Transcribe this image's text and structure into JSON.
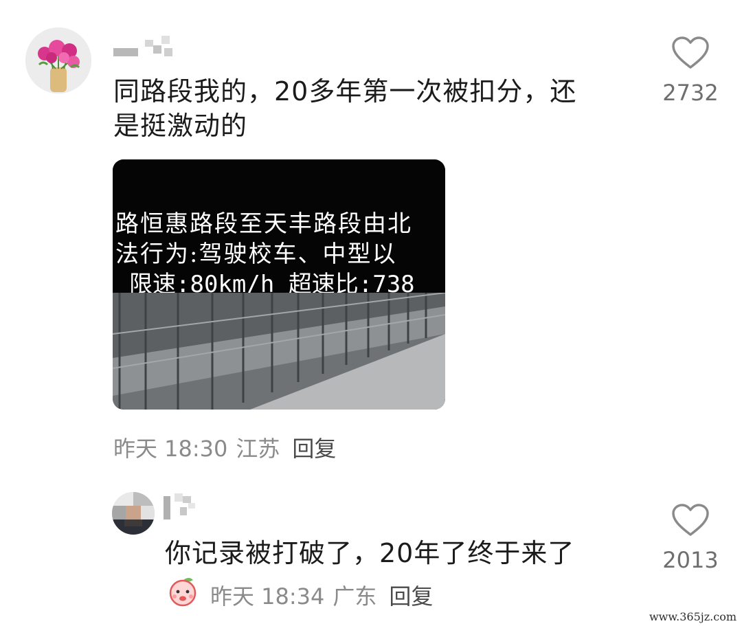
{
  "comments": [
    {
      "text_line1": "同路段我的，20多年第一次被扣分，还",
      "text_line2": "是挺激动的",
      "likes": "2732",
      "time": "昨天 18:30",
      "location": "江苏",
      "reply_label": "回复",
      "image": {
        "caption_line1": "路恒惠路段至天丰路段由北",
        "caption_line2": "法行为:驾驶校车、中型以",
        "caption_line3": "限速:80km/h 超速比:738"
      }
    },
    {
      "text": "你记录被打破了，20年了终于来了",
      "likes": "2013",
      "time": "昨天 18:34",
      "location": "广东",
      "reply_label": "回复"
    }
  ],
  "icons": {
    "like": "heart-outline-icon",
    "sticker": "peach-sticker-icon"
  },
  "watermark": "www.365jz.com",
  "colors": {
    "text_primary": "#1b1b1b",
    "text_meta": "#8a8a8a",
    "like_count": "#6e6e6e"
  }
}
